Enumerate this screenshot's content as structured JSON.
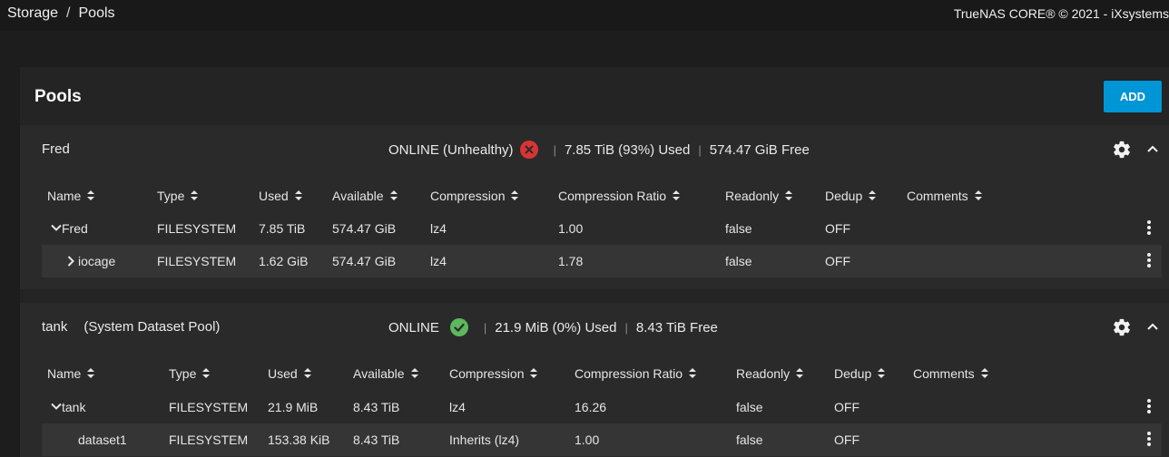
{
  "topbar": {
    "breadcrumb": [
      "Storage",
      "Pools"
    ],
    "breadcrumb_separator": "/",
    "copyright": "TrueNAS CORE® © 2021 - iXsystems"
  },
  "page": {
    "title": "Pools",
    "add_label": "ADD"
  },
  "columns_sort_icon": "sort-updown-icon",
  "pools": [
    {
      "name": "Fred",
      "subtitle": "",
      "state": "ONLINE (Unhealthy)",
      "health": "unhealthy",
      "health_icon": "error-circle-icon",
      "used": "7.85 TiB (93%) Used",
      "free": "574.47 GiB Free",
      "columns": [
        "Name",
        "Type",
        "Used",
        "Available",
        "Compression",
        "Compression Ratio",
        "Readonly",
        "Dedup",
        "Comments"
      ],
      "rows": [
        {
          "expander": "chevron-down-icon",
          "name": "Fred",
          "type": "FILESYSTEM",
          "used": "7.85 TiB",
          "available": "574.47 GiB",
          "compression": "lz4",
          "ratio": "1.00",
          "readonly": "false",
          "dedup": "OFF",
          "comments": ""
        },
        {
          "expander": "chevron-right-icon",
          "name": "iocage",
          "type": "FILESYSTEM",
          "used": "1.62 GiB",
          "available": "574.47 GiB",
          "compression": "lz4",
          "ratio": "1.78",
          "readonly": "false",
          "dedup": "OFF",
          "comments": ""
        }
      ]
    },
    {
      "name": "tank",
      "subtitle": "(System Dataset Pool)",
      "state": "ONLINE",
      "health": "healthy",
      "health_icon": "check-circle-icon",
      "used": "21.9 MiB (0%) Used",
      "free": "8.43 TiB Free",
      "columns": [
        "Name",
        "Type",
        "Used",
        "Available",
        "Compression",
        "Compression Ratio",
        "Readonly",
        "Dedup",
        "Comments"
      ],
      "rows": [
        {
          "expander": "chevron-down-icon",
          "name": "tank",
          "type": "FILESYSTEM",
          "used": "21.9 MiB",
          "available": "8.43 TiB",
          "compression": "lz4",
          "ratio": "16.26",
          "readonly": "false",
          "dedup": "OFF",
          "comments": ""
        },
        {
          "expander": "",
          "name": "dataset1",
          "type": "FILESYSTEM",
          "used": "153.38 KiB",
          "available": "8.43 TiB",
          "compression": "Inherits (lz4)",
          "ratio": "1.00",
          "readonly": "false",
          "dedup": "OFF",
          "comments": ""
        }
      ]
    }
  ]
}
